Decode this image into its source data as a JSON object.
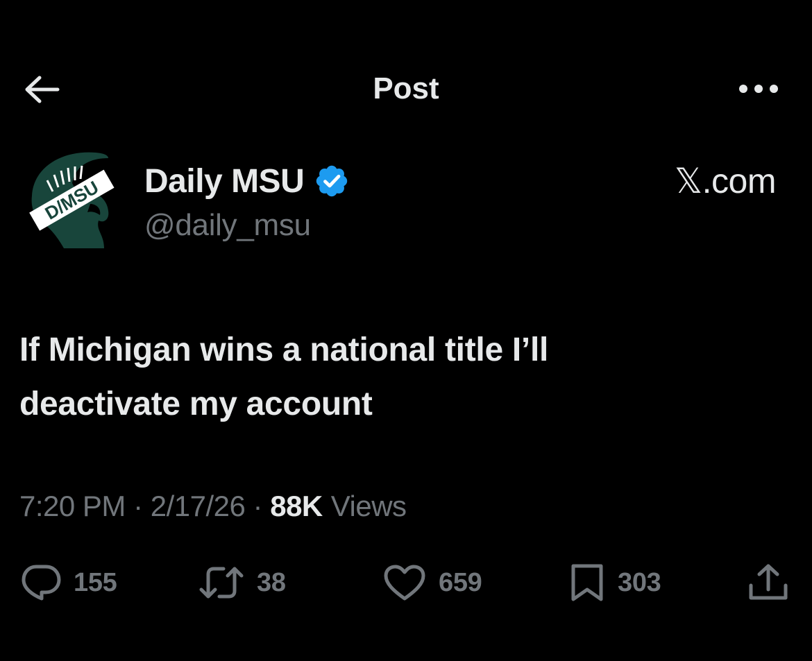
{
  "header": {
    "title": "Post",
    "back_icon": "arrow-left-icon",
    "more_icon": "more-horizontal-icon"
  },
  "author": {
    "display_name": "Daily MSU",
    "handle": "@daily_msu",
    "verified": true,
    "avatar_text": "D/MSU",
    "avatar_color": "#18453b"
  },
  "source_label": "𝕏.com",
  "tweet": {
    "text_line1": "If Michigan wins a national title I’ll",
    "text_line2": "deactivate my account"
  },
  "meta": {
    "time": "7:20 PM",
    "sep1": " · ",
    "date": "2/17/26",
    "sep2": " · ",
    "views_count": "88K",
    "views_label": "Views"
  },
  "actions": {
    "reply_count": "155",
    "repost_count": "38",
    "like_count": "659",
    "bookmark_count": "303"
  },
  "colors": {
    "background": "#000000",
    "text_primary": "#e7e9ea",
    "text_secondary": "#71767b",
    "verified_blue": "#1d9bf0"
  }
}
